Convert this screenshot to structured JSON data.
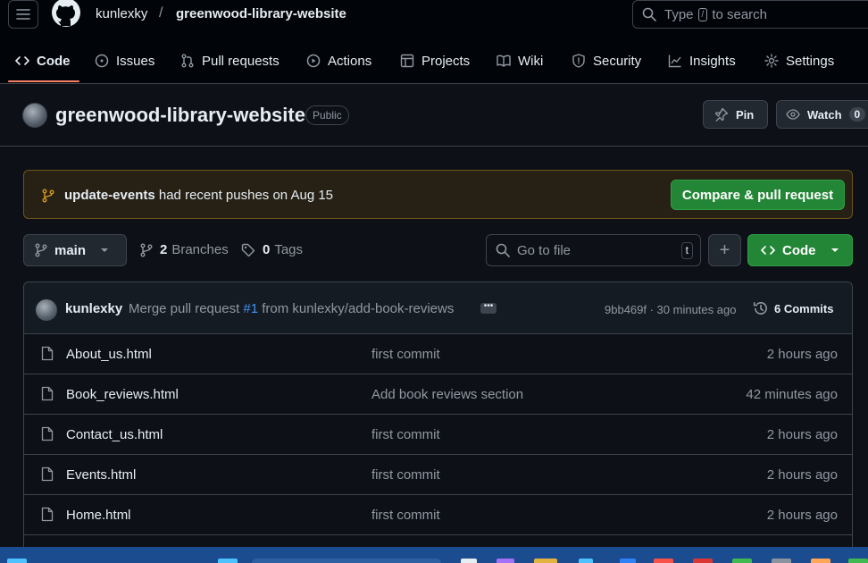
{
  "header": {
    "owner": "kunlexky",
    "separator": "/",
    "repo": "greenwood-library-website",
    "search_prefix": "Type",
    "search_key": "/",
    "search_suffix": "to search"
  },
  "nav": {
    "tabs": [
      {
        "label": "Code",
        "icon": "code-icon"
      },
      {
        "label": "Issues",
        "icon": "issue-icon"
      },
      {
        "label": "Pull requests",
        "icon": "pull-request-icon"
      },
      {
        "label": "Actions",
        "icon": "play-icon"
      },
      {
        "label": "Projects",
        "icon": "table-icon"
      },
      {
        "label": "Wiki",
        "icon": "book-icon"
      },
      {
        "label": "Security",
        "icon": "shield-icon"
      },
      {
        "label": "Insights",
        "icon": "graph-icon"
      },
      {
        "label": "Settings",
        "icon": "gear-icon"
      }
    ],
    "active": "Code"
  },
  "repo": {
    "title": "greenwood-library-website",
    "visibility": "Public",
    "pin_label": "Pin",
    "watch_label": "Watch",
    "watch_count": "0"
  },
  "banner": {
    "branch": "update-events",
    "message": "had recent pushes on Aug 15",
    "button": "Compare & pull request"
  },
  "branch_bar": {
    "branch": "main",
    "branches_count": "2",
    "branches_label": "Branches",
    "tags_count": "0",
    "tags_label": "Tags",
    "goto_placeholder": "Go to file",
    "goto_key": "t",
    "plus": "+",
    "code_button": "Code"
  },
  "latest_commit": {
    "author": "kunlexky",
    "message_prefix": "Merge pull request",
    "pr": "#1",
    "message_suffix": "from kunlexky/add-book-reviews",
    "ellipsis": "•••",
    "hash_time": "9bb469f · 30 minutes ago",
    "commits": "6 Commits"
  },
  "files": [
    {
      "name": "About_us.html",
      "commit": "first commit",
      "time": "2 hours ago"
    },
    {
      "name": "Book_reviews.html",
      "commit": "Add book reviews section",
      "time": "42 minutes ago"
    },
    {
      "name": "Contact_us.html",
      "commit": "first commit",
      "time": "2 hours ago"
    },
    {
      "name": "Events.html",
      "commit": "first commit",
      "time": "2 hours ago"
    },
    {
      "name": "Home.html",
      "commit": "first commit",
      "time": "2 hours ago"
    }
  ],
  "colors": {
    "bg": "#0d1117",
    "header_bg": "#010409",
    "border": "#3d444d",
    "accent_green": "#238636",
    "link_blue": "#4493f8",
    "tab_underline": "#f78166",
    "banner_bg": "#272115",
    "banner_border": "#6b5519",
    "taskbar": "#1b4c8f"
  }
}
